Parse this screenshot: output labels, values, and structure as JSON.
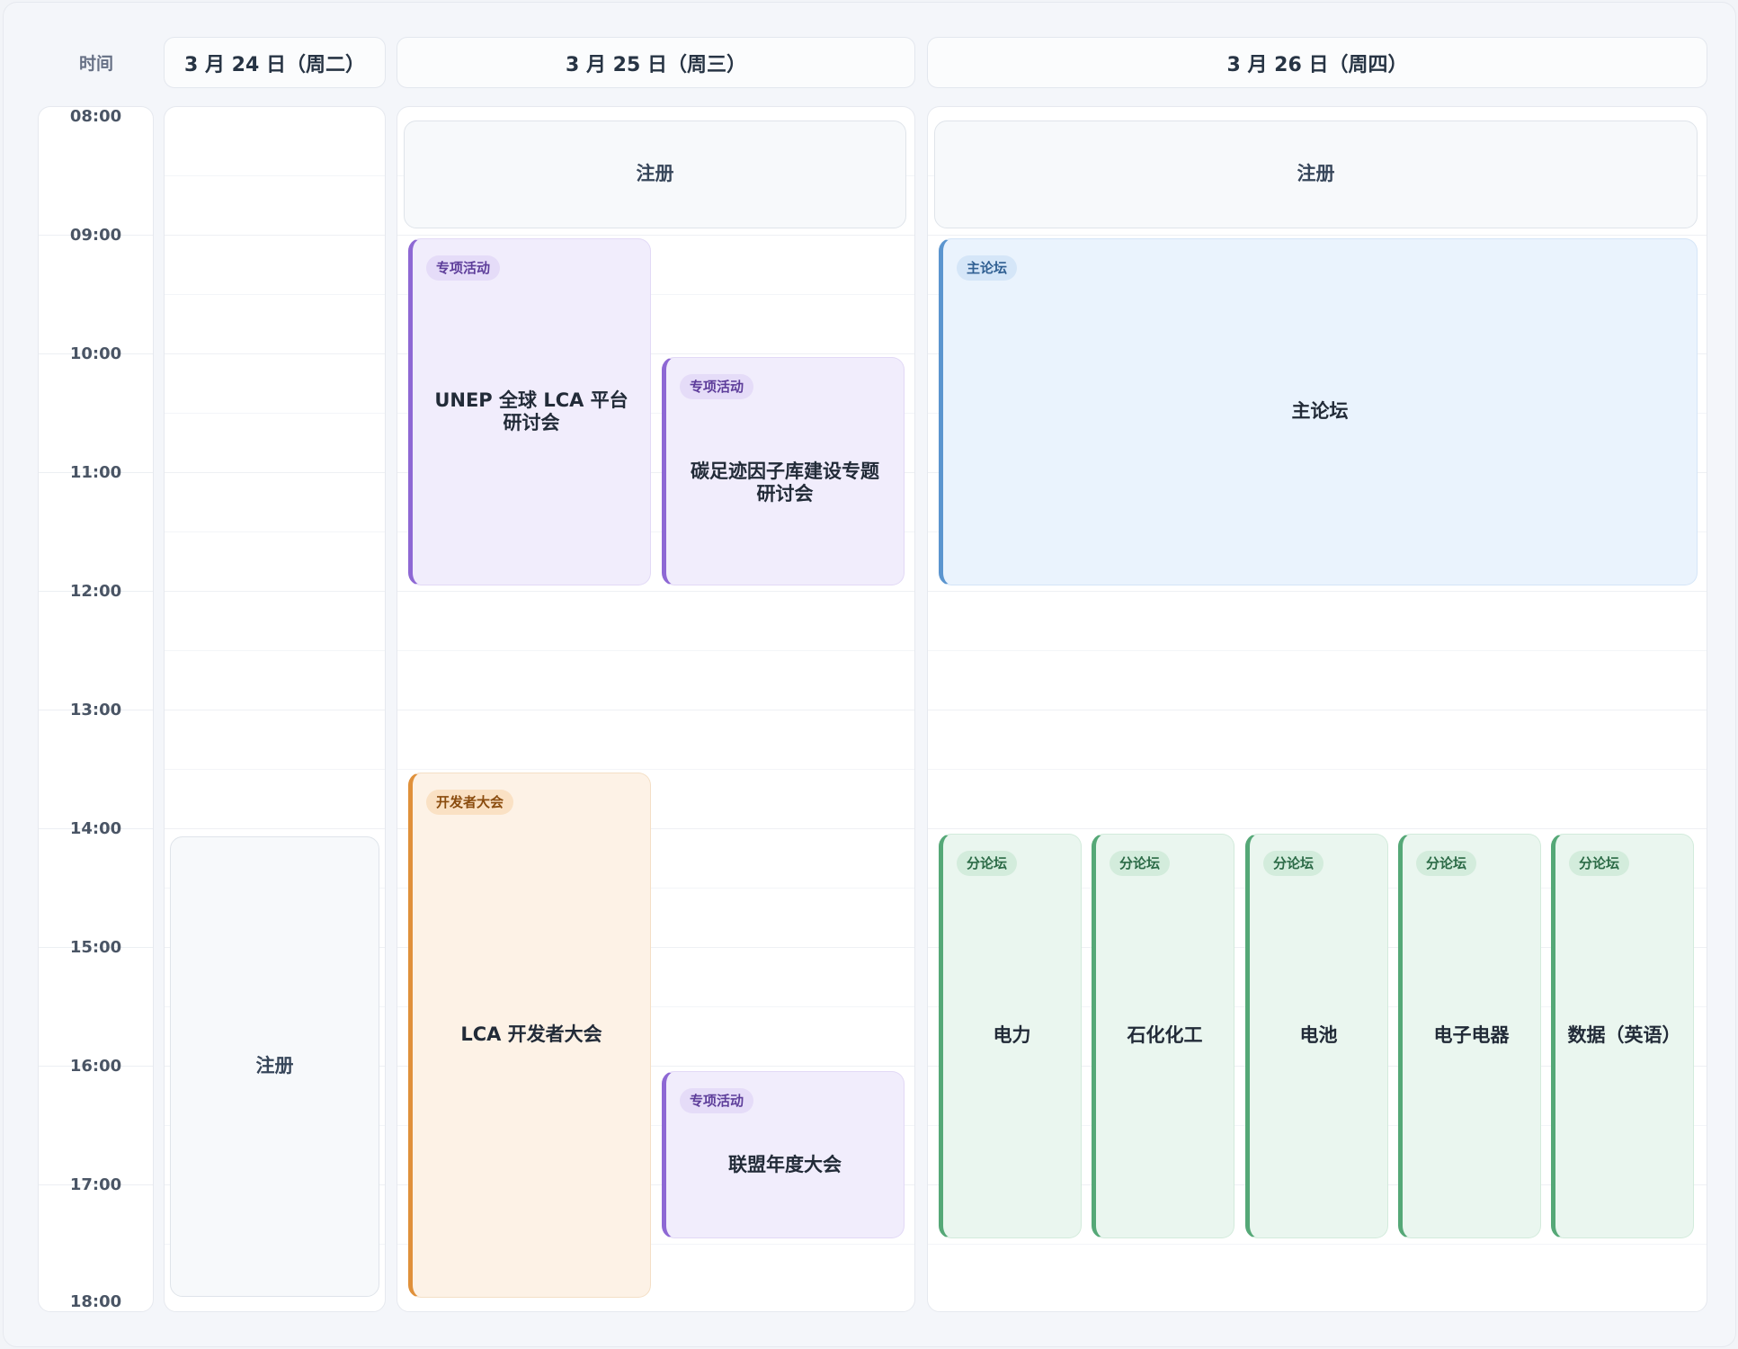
{
  "header": {
    "time_label": "时间",
    "days": [
      "3 月 24 日（周二）",
      "3 月 25 日（周三）",
      "3 月 26 日（周四）"
    ]
  },
  "times": [
    "08:00",
    "09:00",
    "10:00",
    "11:00",
    "12:00",
    "13:00",
    "14:00",
    "15:00",
    "16:00",
    "17:00",
    "18:00"
  ],
  "events": {
    "d1_registration": {
      "title": "注册",
      "start": "14:00",
      "end": "17:50"
    },
    "d2_registration": {
      "title": "注册",
      "start": "08:00",
      "end": "09:00"
    },
    "d2_unep": {
      "tag": "专项活动",
      "title": "UNEP 全球 LCA 平台研讨会",
      "start": "09:00",
      "end": "12:00"
    },
    "d2_carbon": {
      "tag": "专项活动",
      "title": "碳足迹因子库建设专题研讨会",
      "start": "10:00",
      "end": "12:00"
    },
    "d2_dev": {
      "tag": "开发者大会",
      "title": "LCA 开发者大会",
      "start": "13:30",
      "end": "18:00"
    },
    "d2_alliance": {
      "tag": "专项活动",
      "title": "联盟年度大会",
      "start": "16:00",
      "end": "17:30"
    },
    "d3_registration": {
      "title": "注册",
      "start": "08:00",
      "end": "09:00"
    },
    "d3_main": {
      "tag": "主论坛",
      "title": "主论坛",
      "start": "09:00",
      "end": "12:00"
    },
    "d3_power": {
      "tag": "分论坛",
      "title": "电力",
      "start": "14:00",
      "end": "17:30"
    },
    "d3_petro": {
      "tag": "分论坛",
      "title": "石化化工",
      "start": "14:00",
      "end": "17:30"
    },
    "d3_battery": {
      "tag": "分论坛",
      "title": "电池",
      "start": "14:00",
      "end": "17:30"
    },
    "d3_electronics": {
      "tag": "分论坛",
      "title": "电子电器",
      "start": "14:00",
      "end": "17:30"
    },
    "d3_data": {
      "tag": "分论坛",
      "title": "数据（英语）",
      "start": "14:00",
      "end": "17:30"
    }
  },
  "colors": {
    "special": "#8e68d4",
    "developer": "#e0903a",
    "main_forum": "#5b95cf",
    "sub_forum": "#55a877",
    "registration": "#dfe4ea"
  }
}
